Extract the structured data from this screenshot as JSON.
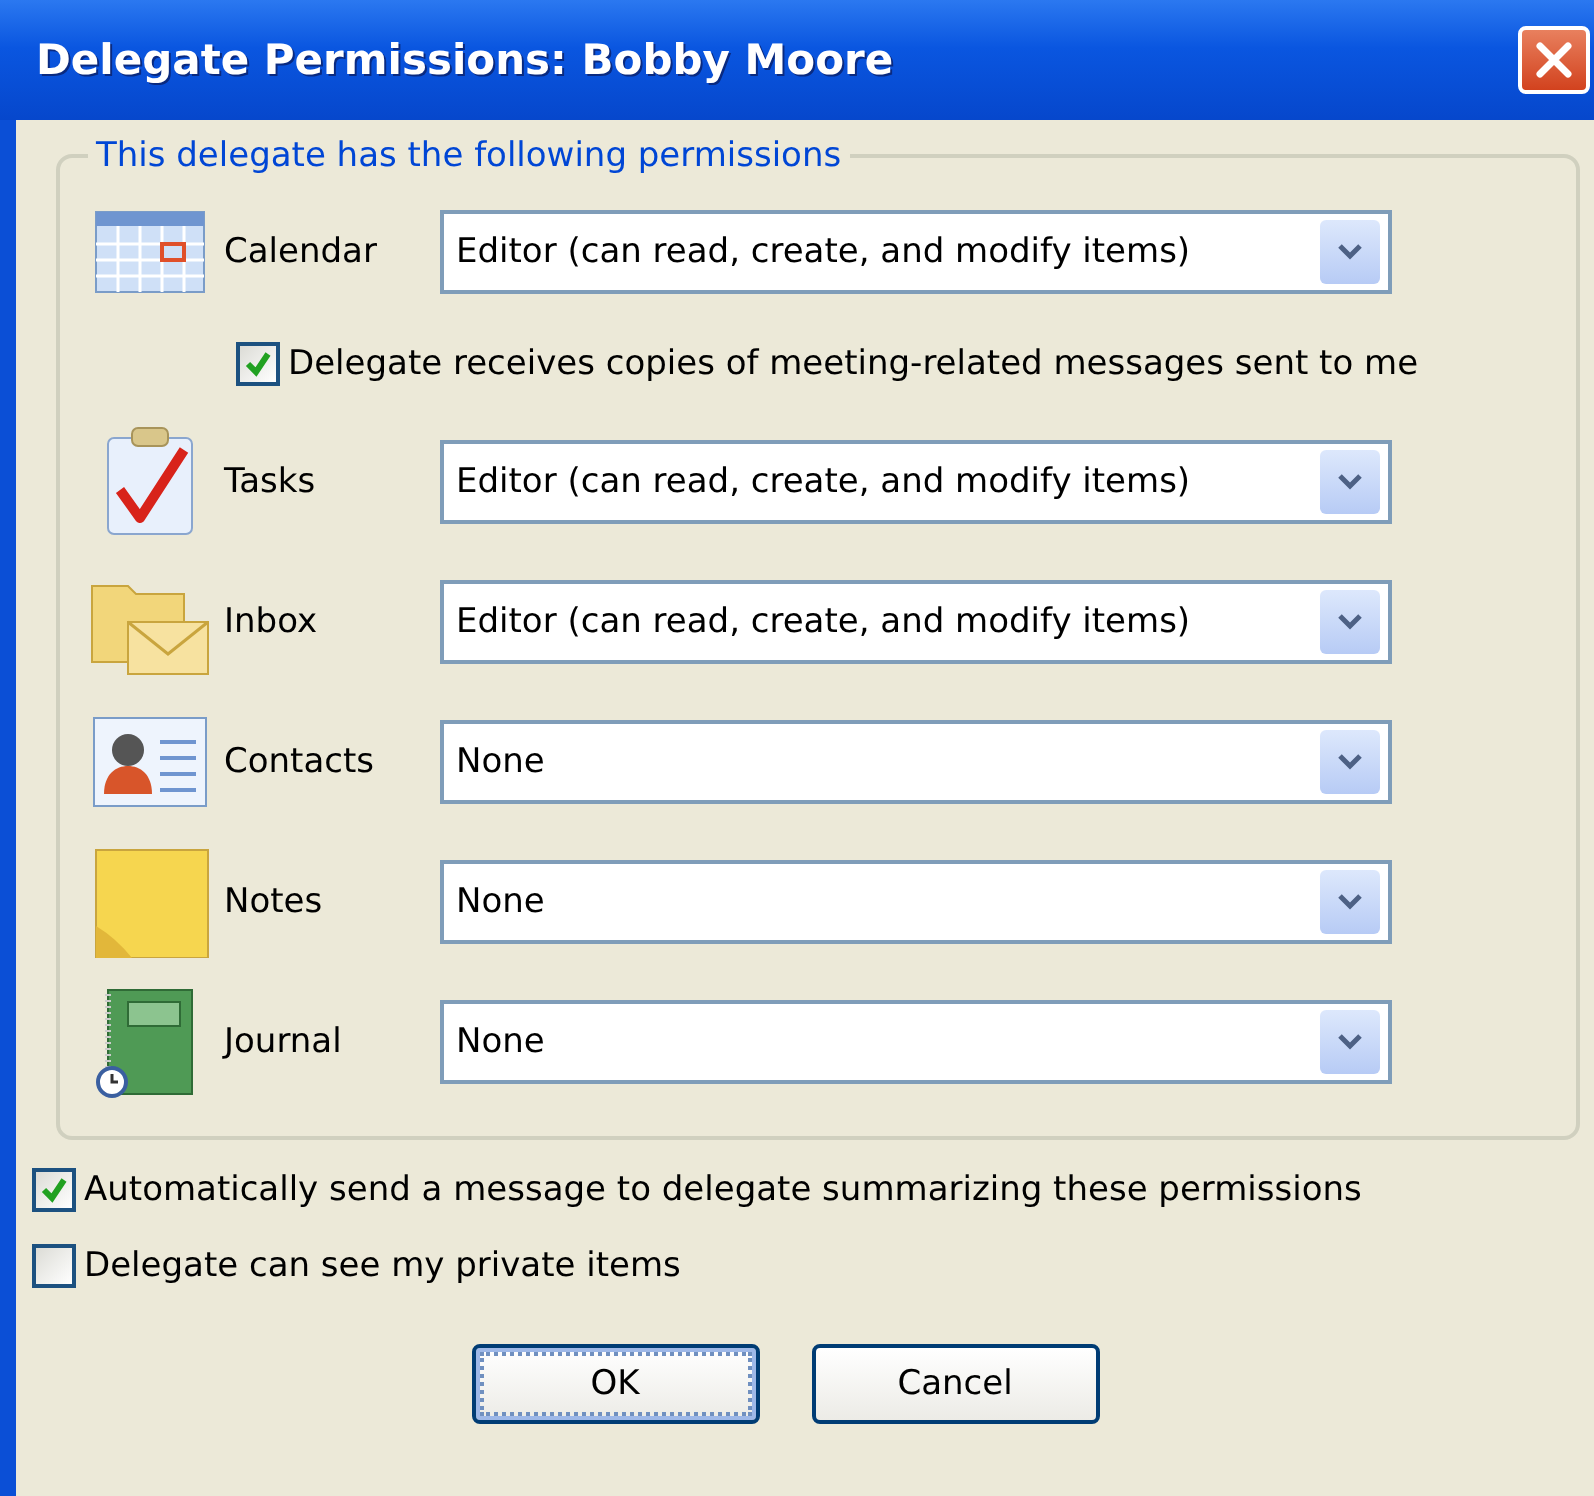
{
  "window": {
    "title": "Delegate Permissions: Bobby Moore"
  },
  "group": {
    "legend": "This delegate has the following permissions"
  },
  "permissions": [
    {
      "folder": "Calendar",
      "level": "Editor (can read, create, and modify items)",
      "option": {
        "label": "Delegate receives copies of meeting-related messages sent to me",
        "checked": true
      }
    },
    {
      "folder": "Tasks",
      "level": "Editor (can read, create, and modify items)"
    },
    {
      "folder": "Inbox",
      "level": "Editor (can read, create, and modify items)"
    },
    {
      "folder": "Contacts",
      "level": "None"
    },
    {
      "folder": "Notes",
      "level": "None"
    },
    {
      "folder": "Journal",
      "level": "None"
    }
  ],
  "options": [
    {
      "label": "Automatically send a message to delegate summarizing these permissions",
      "checked": true
    },
    {
      "label": "Delegate can see my private items",
      "checked": false
    }
  ],
  "buttons": [
    {
      "label": "OK",
      "default": true
    },
    {
      "label": "Cancel",
      "default": false
    }
  ]
}
